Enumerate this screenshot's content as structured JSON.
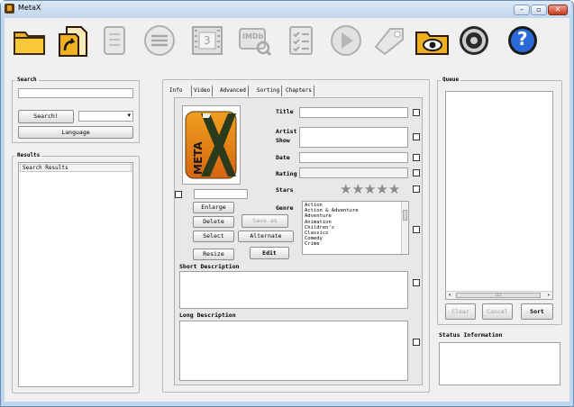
{
  "window": {
    "title": "MetaX",
    "minimize": "–",
    "maximize": "▫",
    "close": "✕"
  },
  "toolbar": {
    "icons": [
      "open-folder-icon",
      "open-file-icon",
      "document-icon",
      "tracks-icon",
      "film-icon",
      "imdb-search-icon",
      "checklist-icon",
      "play-icon",
      "tag-icon",
      "preview-folder-icon",
      "sound-icon",
      "help-icon"
    ],
    "film_label": "3",
    "imdb_label": "IMDb",
    "help_label": "?"
  },
  "search": {
    "group_label": "Search",
    "query_value": "",
    "button_label": "Search!",
    "combo_value": "",
    "language_label": "Language"
  },
  "results": {
    "group_label": "Results",
    "header": "Search Results",
    "rows": []
  },
  "tabs": [
    "Info",
    "Video",
    "Advanced",
    "Sorting",
    "Chapters"
  ],
  "artwork": {
    "text": "META"
  },
  "art_buttons": {
    "enlarge": "Enlarge",
    "delete": "Delete",
    "select": "Select",
    "resize": "Resize",
    "save_as": "Save as",
    "alternate": "Alternate",
    "edit": "Edit"
  },
  "fields": {
    "title_label": "Title",
    "title_value": "",
    "artist_label": "Artist\nShow",
    "artist_value": "",
    "date_label": "Date",
    "date_value": "",
    "rating_label": "Rating",
    "rating_value": "",
    "stars_label": "Stars",
    "stars_value": 0,
    "stars_max": 5,
    "genre_label": "Genre",
    "genres": [
      "Action",
      "Action & Adventure",
      "Adventure",
      "Animation",
      "Children's",
      "Classics",
      "Comedy",
      "Crime"
    ],
    "short_desc_label": "Short Description",
    "short_desc_value": "",
    "long_desc_label": "Long Description",
    "long_desc_value": ""
  },
  "queue": {
    "group_label": "Queue",
    "items": [],
    "clear": "Clear",
    "cancel": "Cancel",
    "sort": "Sort",
    "scroll_mark": "III"
  },
  "status": {
    "label": "Status Information",
    "value": ""
  }
}
